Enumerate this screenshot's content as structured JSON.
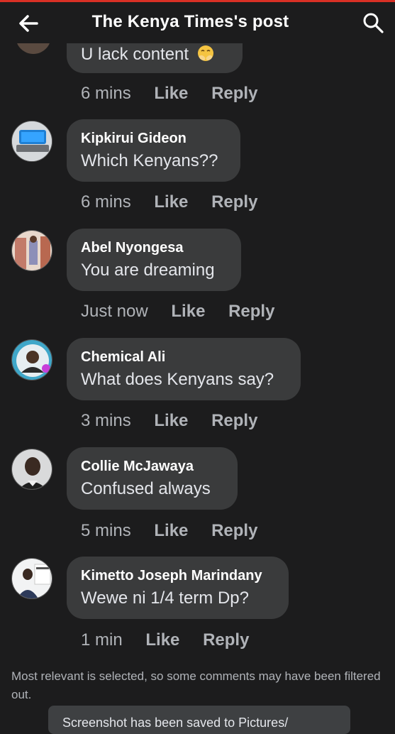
{
  "header": {
    "title": "The Kenya Times's post"
  },
  "partial_comment": {
    "text": "U lack content"
  },
  "partial_actions": {
    "time": "6 mins",
    "like": "Like",
    "reply": "Reply"
  },
  "comments": [
    {
      "name": "Kipkirui Gideon",
      "text": "Which Kenyans??",
      "time": "6 mins",
      "like": "Like",
      "reply": "Reply"
    },
    {
      "name": "Abel Nyongesa",
      "text": "You are dreaming",
      "time": "Just now",
      "like": "Like",
      "reply": "Reply"
    },
    {
      "name": "Chemical Ali",
      "text": "What does Kenyans say?",
      "time": "3 mins",
      "like": "Like",
      "reply": "Reply"
    },
    {
      "name": "Collie McJawaya",
      "text": "Confused always",
      "time": "5 mins",
      "like": "Like",
      "reply": "Reply"
    },
    {
      "name": "Kimetto Joseph Marindany",
      "text": "Wewe ni 1/4 term Dp?",
      "time": "1 min",
      "like": "Like",
      "reply": "Reply"
    }
  ],
  "footer": {
    "notice": "Most relevant is selected, so some comments may have been filtered out.",
    "toast": "Screenshot has been saved to Pictures/"
  },
  "colors": {
    "background": "#1c1c1d",
    "bubble": "#3a3b3c",
    "secondary_text": "#b0b3b8",
    "status_line": "#d93025"
  }
}
